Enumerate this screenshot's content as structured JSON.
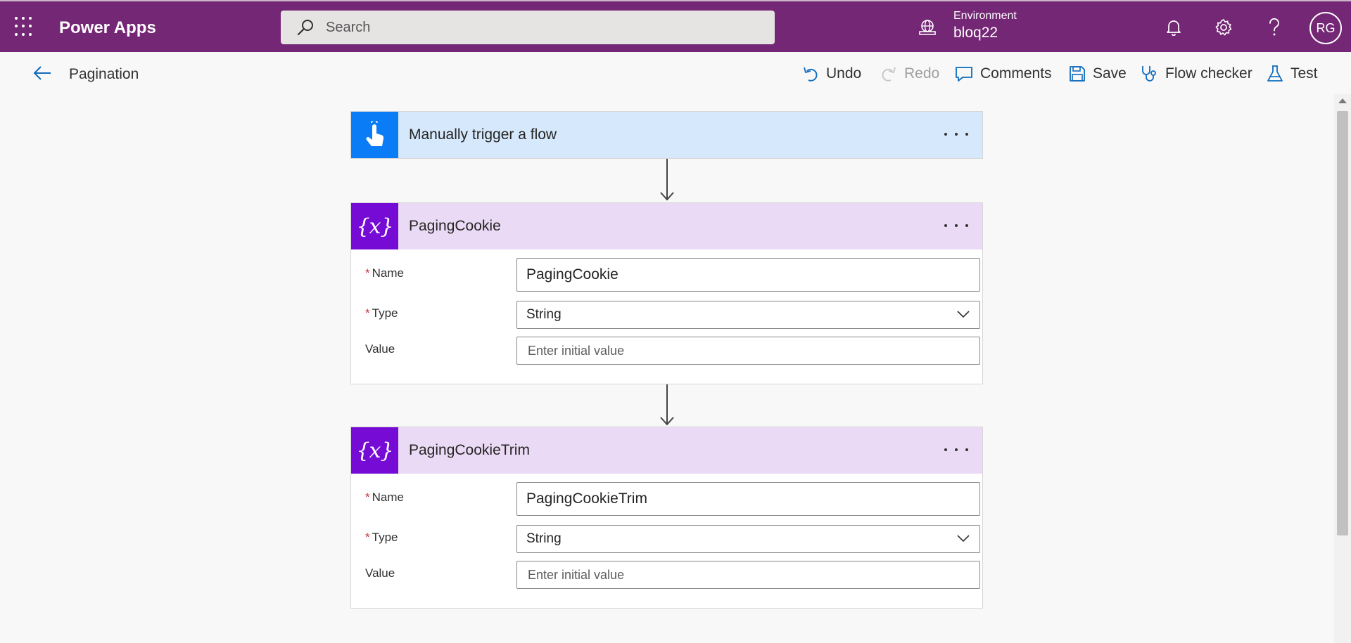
{
  "header": {
    "app_title": "Power Apps",
    "search_placeholder": "Search",
    "environment_label": "Environment",
    "environment_value": "bloq22",
    "avatar_initials": "RG",
    "bar_color": "#742774"
  },
  "command_bar": {
    "flow_name": "Pagination",
    "undo_label": "Undo",
    "redo_label": "Redo",
    "comments_label": "Comments",
    "save_label": "Save",
    "flow_checker_label": "Flow checker",
    "test_label": "Test"
  },
  "trigger": {
    "title": "Manually trigger a flow",
    "color": "#0a7cf5"
  },
  "variables": [
    {
      "title": "PagingCookie",
      "name_label": "Name",
      "name_value": "PagingCookie",
      "type_label": "Type",
      "type_value": "String",
      "value_label": "Value",
      "value_placeholder": "Enter initial value"
    },
    {
      "title": "PagingCookieTrim",
      "name_label": "Name",
      "name_value": "PagingCookieTrim",
      "type_label": "Type",
      "type_value": "String",
      "value_label": "Value",
      "value_placeholder": "Enter initial value"
    }
  ],
  "required_marker": "*",
  "variable_icon_glyph": "{x}",
  "icons": {
    "waffle": "app-launcher-icon",
    "search": "search-icon",
    "environment": "globe-icon",
    "notifications": "bell-icon",
    "settings": "gear-icon",
    "help": "question-mark-icon",
    "back": "arrow-left-icon",
    "undo": "undo-icon",
    "redo": "redo-icon",
    "comments": "comment-icon",
    "save": "save-icon",
    "flow_checker": "stethoscope-icon",
    "test": "flask-icon",
    "trigger": "touch-hand-icon",
    "variable": "variable-braces-icon"
  }
}
